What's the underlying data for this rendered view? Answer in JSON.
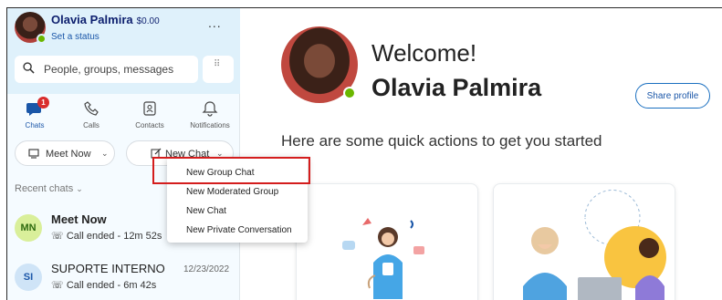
{
  "user": {
    "name": "Olavia Palmira",
    "balance": "$0.00",
    "status_link": "Set a status"
  },
  "sidebar": {
    "more_label": "...",
    "search_placeholder": "People, groups, messages",
    "nav": [
      {
        "label": "Chats",
        "icon": "chat-icon",
        "badge": "1"
      },
      {
        "label": "Calls",
        "icon": "phone-icon"
      },
      {
        "label": "Contacts",
        "icon": "contacts-icon"
      },
      {
        "label": "Notifications",
        "icon": "bell-icon"
      }
    ],
    "meet_now": "Meet Now",
    "new_chat": "New Chat",
    "recent_chats": "Recent chats",
    "chats": [
      {
        "initials": "MN",
        "title": "Meet Now",
        "subtitle": "Call ended - 12m 52s",
        "date": ""
      },
      {
        "initials": "SI",
        "title": "SUPORTE INTERNO",
        "subtitle": "Call ended - 6m 42s",
        "date": "12/23/2022"
      }
    ]
  },
  "dropdown": {
    "items": [
      "New Group Chat",
      "New Moderated Group",
      "New Chat",
      "New Private Conversation"
    ]
  },
  "main": {
    "welcome": "Welcome!",
    "full_name": "Olavia Palmira",
    "share_profile": "Share profile",
    "quick_actions": "Here are some quick actions to get you started"
  },
  "colors": {
    "accent": "#1a56a8",
    "sidebar_top": "#dff1fb",
    "highlight": "#d41d1d",
    "presence": "#6bb700",
    "badge": "#d92c2c"
  }
}
